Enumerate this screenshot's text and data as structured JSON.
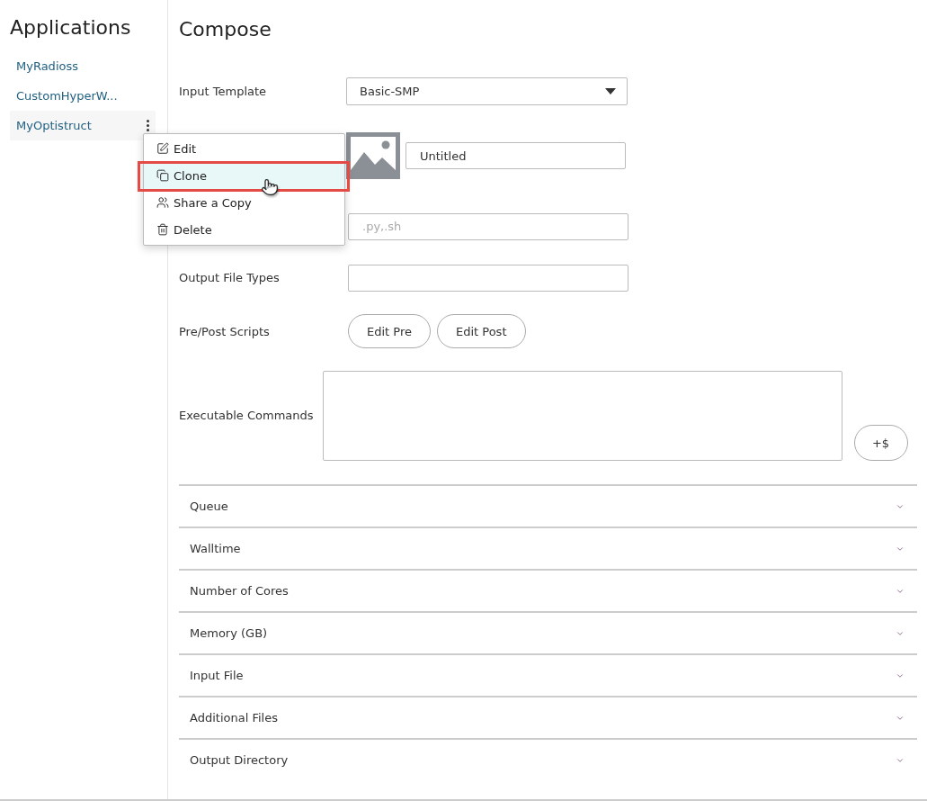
{
  "sidebar": {
    "title": "Applications",
    "items": [
      {
        "label": "MyRadioss",
        "selected": false
      },
      {
        "label": "CustomHyperW...",
        "selected": false
      },
      {
        "label": "MyOptistruct",
        "selected": true
      }
    ]
  },
  "context_menu": {
    "items": [
      {
        "label": "Edit",
        "kind": "edit",
        "selected": false
      },
      {
        "label": "Clone",
        "kind": "clone",
        "selected": true
      },
      {
        "label": "Share a Copy",
        "kind": "share",
        "selected": false
      },
      {
        "label": "Delete",
        "kind": "delete",
        "selected": false
      }
    ]
  },
  "compose": {
    "title": "Compose",
    "rows": [
      {
        "kind": "select",
        "label": "Input Template",
        "value": "Basic-SMP"
      },
      {
        "kind": "image_name",
        "value": "Untitled"
      },
      {
        "kind": "text",
        "placeholder": ".py,.sh"
      },
      {
        "kind": "text",
        "label": "Output File Types"
      },
      {
        "kind": "buttons",
        "label": "Pre/Post Scripts",
        "buttons": [
          "Edit Pre",
          "Edit Post"
        ]
      },
      {
        "kind": "textarea",
        "label": "Executable Commands",
        "side_button": "+$"
      }
    ],
    "sections": [
      {
        "label": "Queue",
        "expanded": false
      },
      {
        "label": "Walltime",
        "expanded": false
      },
      {
        "label": "Number of Cores",
        "expanded": false
      },
      {
        "label": "Memory (GB)",
        "expanded": false
      },
      {
        "label": "Input File",
        "expanded": false
      },
      {
        "label": "Additional Files",
        "expanded": false
      },
      {
        "label": "Output Directory",
        "expanded": false
      }
    ]
  }
}
